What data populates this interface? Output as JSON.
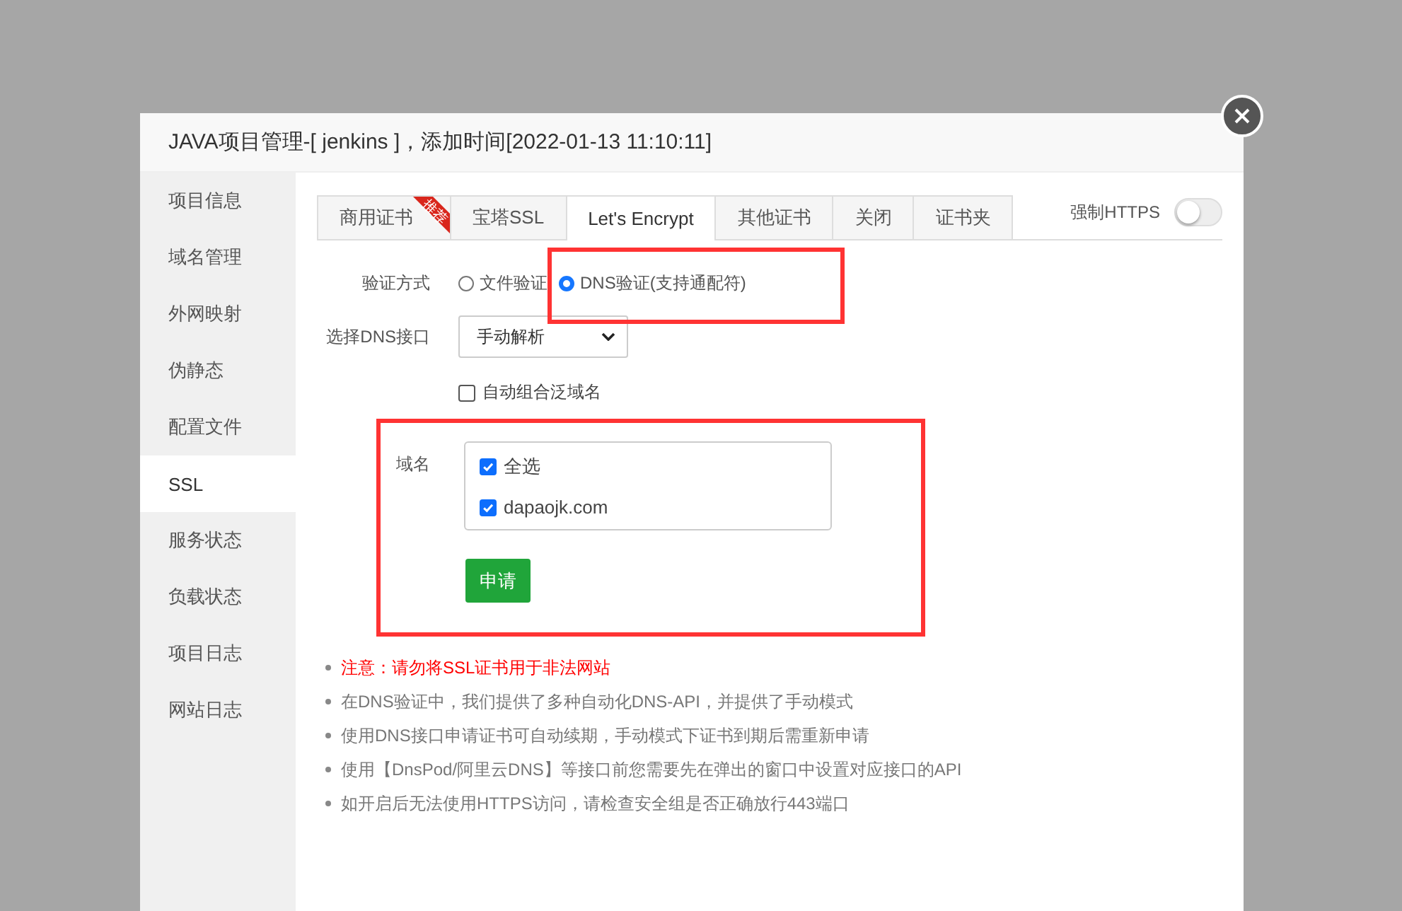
{
  "dialog": {
    "title": "JAVA项目管理-[ jenkins ]，添加时间[2022-01-13 11:10:11]"
  },
  "sidebar": {
    "items": [
      {
        "label": "项目信息",
        "selected": false
      },
      {
        "label": "域名管理",
        "selected": false
      },
      {
        "label": "外网映射",
        "selected": false
      },
      {
        "label": "伪静态",
        "selected": false
      },
      {
        "label": "配置文件",
        "selected": false
      },
      {
        "label": "SSL",
        "selected": true
      },
      {
        "label": "服务状态",
        "selected": false
      },
      {
        "label": "负载状态",
        "selected": false
      },
      {
        "label": "项目日志",
        "selected": false
      },
      {
        "label": "网站日志",
        "selected": false
      }
    ]
  },
  "tabs": [
    {
      "label": "商用证书",
      "selected": false,
      "badge": "推荐"
    },
    {
      "label": "宝塔SSL",
      "selected": false
    },
    {
      "label": "Let's Encrypt",
      "selected": true
    },
    {
      "label": "其他证书",
      "selected": false
    },
    {
      "label": "关闭",
      "selected": false
    },
    {
      "label": "证书夹",
      "selected": false
    }
  ],
  "force_https": {
    "label": "强制HTTPS",
    "on": false
  },
  "form": {
    "verify": {
      "label": "验证方式",
      "options": [
        {
          "label": "文件验证",
          "selected": false
        },
        {
          "label": "DNS验证(支持通配符)",
          "selected": true
        }
      ]
    },
    "dns": {
      "label": "选择DNS接口",
      "value": "手动解析"
    },
    "auto_wildcard": {
      "label": "自动组合泛域名",
      "checked": false
    },
    "domains": {
      "label": "域名",
      "items": [
        {
          "label": "全选",
          "checked": true
        },
        {
          "label": "dapaojk.com",
          "checked": true
        }
      ]
    },
    "apply_button": "申请"
  },
  "notes": [
    {
      "kind": "warning",
      "text": "注意：请勿将SSL证书用于非法网站"
    },
    {
      "kind": "info",
      "text": "在DNS验证中，我们提供了多种自动化DNS-API，并提供了手动模式"
    },
    {
      "kind": "info",
      "text": "使用DNS接口申请证书可自动续期，手动模式下证书到期后需重新申请"
    },
    {
      "kind": "info",
      "text": "使用【DnsPod/阿里云DNS】等接口前您需要先在弹出的窗口中设置对应接口的API"
    },
    {
      "kind": "info",
      "text": "如开启后无法使用HTTPS访问，请检查安全组是否正确放行443端口"
    }
  ]
}
